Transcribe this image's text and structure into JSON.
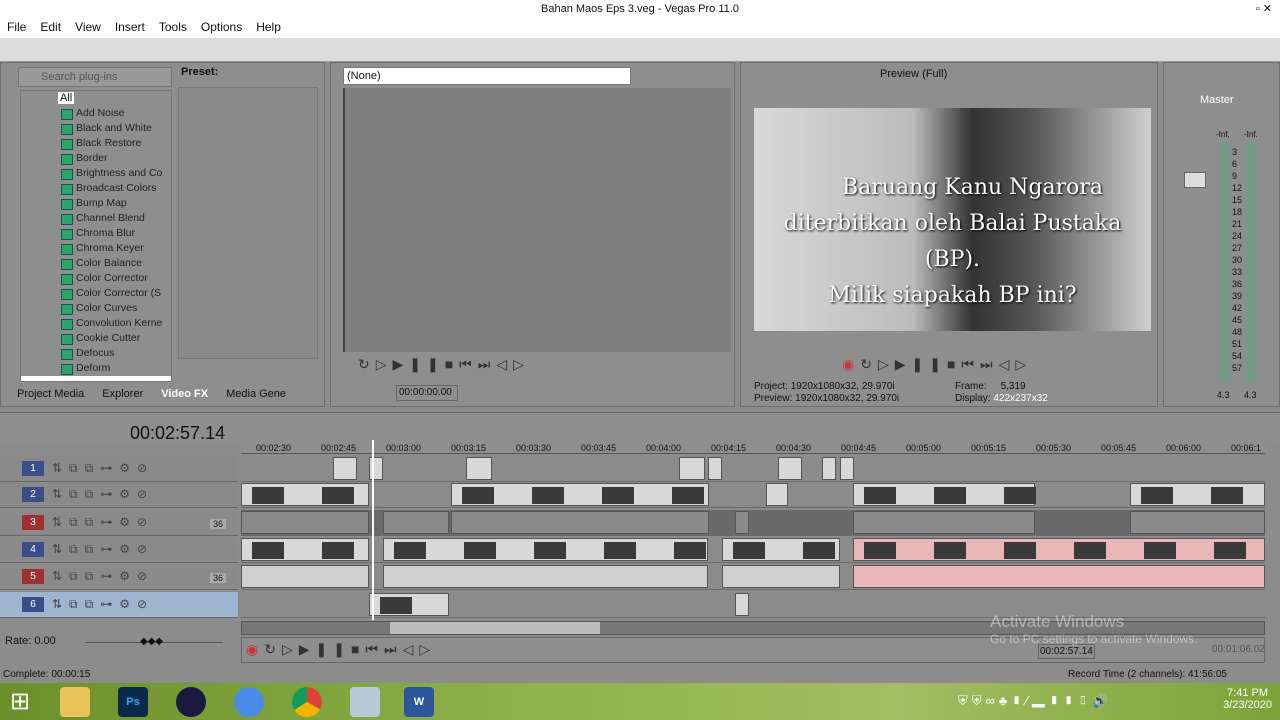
{
  "window": {
    "title": "Bahan Maos Eps 3.veg - Vegas Pro 11.0"
  },
  "menu": [
    "File",
    "Edit",
    "View",
    "Insert",
    "Tools",
    "Options",
    "Help"
  ],
  "plugins": {
    "search_placeholder": "Search plug-ins",
    "preset_label": "Preset:",
    "root": "All",
    "items": [
      "Add Noise",
      "Black and White",
      "Black Restore",
      "Border",
      "Brightness and Co",
      "Broadcast Colors",
      "Bump Map",
      "Channel Blend",
      "Chroma Blur",
      "Chroma Keyer",
      "Color Balance",
      "Color Corrector",
      "Color Corrector (S",
      "Color Curves",
      "Convolution Kerne",
      "Cookie Cutter",
      "Defocus",
      "Deform"
    ]
  },
  "tabs": [
    "Project Media",
    "Explorer",
    "Video FX",
    "Media Gene"
  ],
  "active_tab": "Video FX",
  "trimmer": {
    "select": "(None)",
    "timecode": "00:00:00.00"
  },
  "preview": {
    "mode": "Preview (Full)",
    "caption": [
      "Baruang Kanu Ngarora",
      "diterbitkan oleh Balai Pustaka (BP).",
      "Milik siapakah BP ini?"
    ],
    "project_label": "Project:",
    "project": "1920x1080x32, 29.970i",
    "preview_label": "Preview:",
    "preview": "1920x1080x32, 29.970i",
    "frame_label": "Frame:",
    "frame": "5,319",
    "display_label": "Display:",
    "display": "422x237x32"
  },
  "mixer": {
    "title": "Master",
    "inf": "-Inf.",
    "scale": [
      "3",
      "6",
      "9",
      "12",
      "15",
      "18",
      "21",
      "24",
      "27",
      "30",
      "33",
      "36",
      "39",
      "42",
      "45",
      "48",
      "51",
      "54",
      "57"
    ],
    "left": "4.3",
    "right": "4.3"
  },
  "timeline": {
    "timecode": "00:02:57.14",
    "ruler": [
      "00:02:30",
      "00:02:45",
      "00:03:00",
      "00:03:15",
      "00:03:30",
      "00:03:45",
      "00:04:00",
      "00:04:15",
      "00:04:30",
      "00:04:45",
      "00:05:00",
      "00:05:15",
      "00:05:30",
      "00:05:45",
      "00:06:00",
      "00:06:1"
    ],
    "tracks": [
      {
        "n": "1",
        "type": "video"
      },
      {
        "n": "2",
        "type": "video"
      },
      {
        "n": "3",
        "type": "audio",
        "badge": "36"
      },
      {
        "n": "4",
        "type": "video"
      },
      {
        "n": "5",
        "type": "audio",
        "badge": "36"
      },
      {
        "n": "6",
        "type": "video"
      }
    ],
    "rate": "Rate: 0.00",
    "cursor": "00:02:57.14",
    "length": "00:01:06.02"
  },
  "status": {
    "complete": "Complete: 00:00:15",
    "record": "Record Time (2 channels): 41:56:05"
  },
  "watermark": {
    "title": "Activate Windows",
    "sub": "Go to PC settings to activate Windows."
  },
  "taskbar": {
    "time": "7:41 PM",
    "date": "3/23/2020"
  },
  "colors": {
    "accent": "#3a5fa8",
    "audio_track": "#a03030",
    "video_track": "#3a4f8a",
    "pink_clip": "#e9b7b7"
  }
}
